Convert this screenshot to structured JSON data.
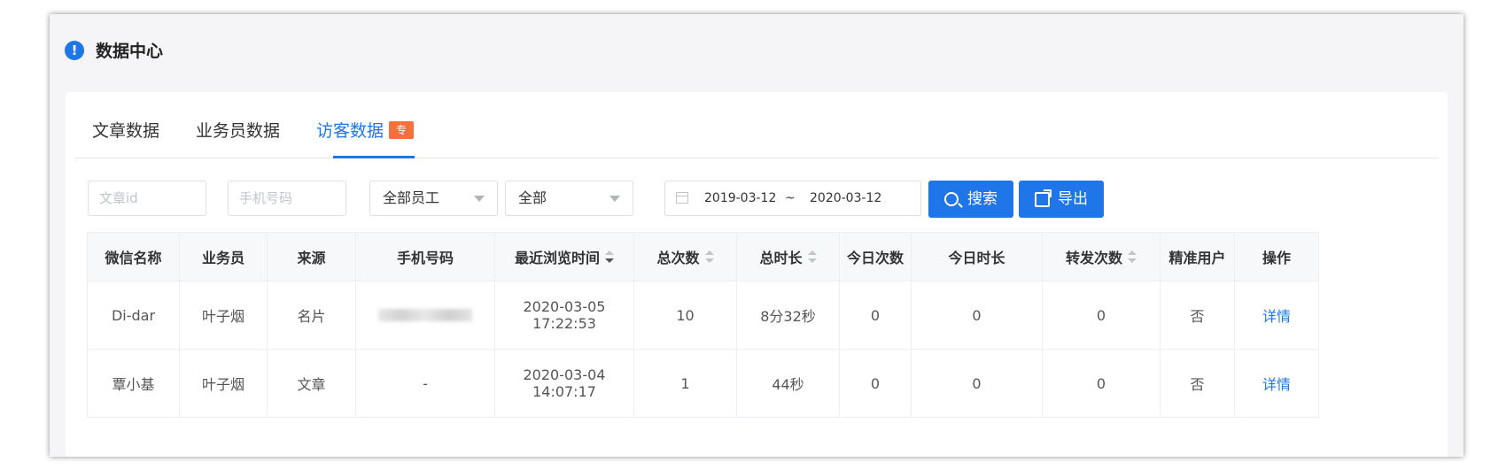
{
  "header": {
    "title": "数据中心",
    "info_icon": "!"
  },
  "tabs": [
    {
      "label": "文章数据",
      "active": false
    },
    {
      "label": "业务员数据",
      "active": false
    },
    {
      "label": "访客数据",
      "active": true,
      "badge": "专"
    }
  ],
  "filters": {
    "article_id_placeholder": "文章id",
    "phone_placeholder": "手机号码",
    "employee_select": "全部员工",
    "source_select": "全部",
    "date_start": "2019-03-12",
    "date_separator": "~",
    "date_end": "2020-03-12",
    "search_label": "搜索",
    "export_label": "导出"
  },
  "table": {
    "columns": [
      "微信名称",
      "业务员",
      "来源",
      "手机号码",
      "最近浏览时间",
      "总次数",
      "总时长",
      "今日次数",
      "今日时长",
      "转发次数",
      "精准用户",
      "操作"
    ],
    "rows": [
      {
        "wechat_name": "Di-dar",
        "salesman": "叶子烟",
        "source": "名片",
        "phone": "",
        "last_visit": "2020-03-05 17:22:53",
        "total_count": "10",
        "total_duration": "8分32秒",
        "today_count": "0",
        "today_duration": "0",
        "forward_count": "0",
        "precise_user": "否",
        "action": "详情"
      },
      {
        "wechat_name": "覃小基",
        "salesman": "叶子烟",
        "source": "文章",
        "phone": "-",
        "last_visit": "2020-03-04 14:07:17",
        "total_count": "1",
        "total_duration": "44秒",
        "today_count": "0",
        "today_duration": "0",
        "forward_count": "0",
        "precise_user": "否",
        "action": "详情"
      }
    ]
  },
  "colors": {
    "primary": "#1e76e8",
    "badge": "#f5703a",
    "border": "#ebeef5",
    "header_bg": "#f7f8fa"
  }
}
